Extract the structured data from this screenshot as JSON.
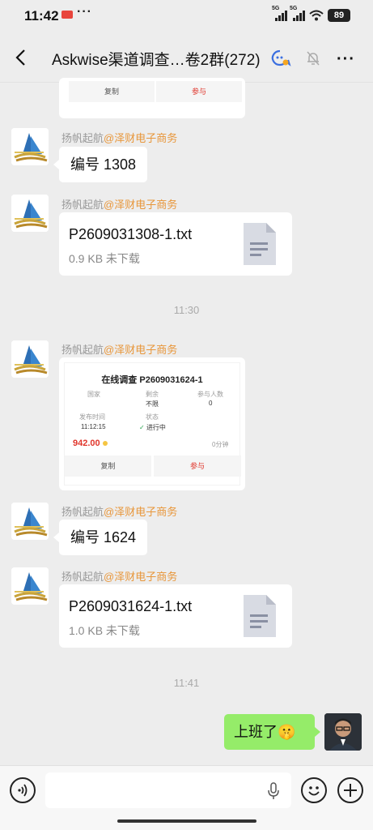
{
  "status": {
    "time": "11:42",
    "notif_badge": "ɑ",
    "more": "···",
    "sig1": "5G",
    "sig2": "5G",
    "battery": "89"
  },
  "header": {
    "title": "Askwise渠道调查…卷2群(272)"
  },
  "top_card": {
    "copy_label": "复制",
    "join_label": "参与"
  },
  "messages": [
    {
      "sender": "扬帆起航",
      "org": "@泽财电子商务",
      "text": "编号 1308"
    },
    {
      "sender": "扬帆起航",
      "org": "@泽财电子商务",
      "file_name": "P2609031308-1.txt",
      "file_meta": "0.9 KB   未下载"
    },
    {
      "sender": "扬帆起航",
      "org": "@泽财电子商务"
    },
    {
      "sender": "扬帆起航",
      "org": "@泽财电子商务",
      "text": "编号 1624"
    },
    {
      "sender": "扬帆起航",
      "org": "@泽财电子商务",
      "file_name": "P2609031624-1.txt",
      "file_meta": "1.0 KB   未下载"
    }
  ],
  "timestamps": {
    "t1": "11:30",
    "t2": "11:41"
  },
  "survey_card": {
    "title": "在线调查 P2609031624-1",
    "country_label": "国家",
    "remaining_label": "剩余",
    "remaining_value": "不限",
    "participants_label": "参与人数",
    "participants_value": "0",
    "publish_label": "发布时间",
    "publish_value": "11:12:15",
    "state_label": "状态",
    "state_value": "进行中",
    "price": "942.00",
    "duration": "0分钟",
    "copy_label": "复制",
    "join_label": "参与"
  },
  "self_message": {
    "text": "上班了🤫"
  },
  "colors": {
    "accent_orange": "#e8963a",
    "self_bubble": "#95ec69",
    "price_red": "#e0352b"
  }
}
